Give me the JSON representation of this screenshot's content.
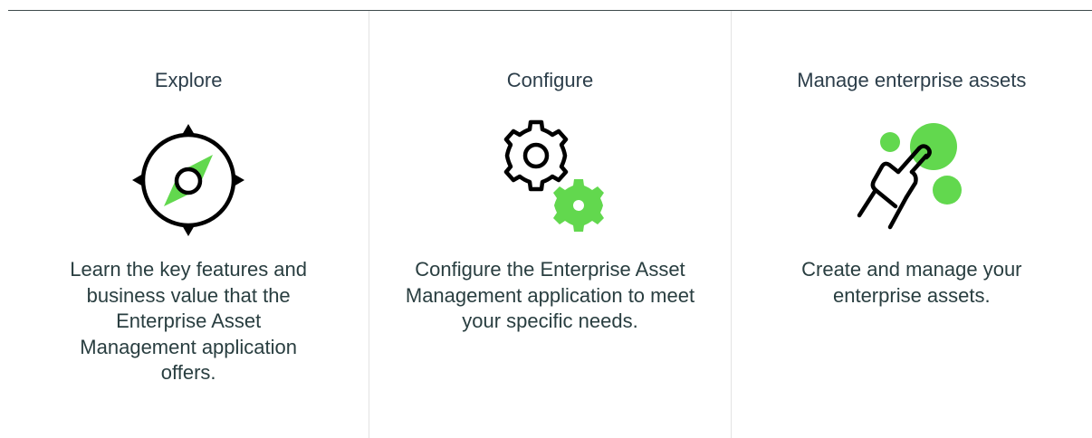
{
  "cards": [
    {
      "title": "Explore",
      "icon": "compass-icon",
      "description": "Learn the key features and business value that the Enterprise Asset Management application offers."
    },
    {
      "title": "Configure",
      "icon": "gears-icon",
      "description": "Configure the Enterprise Asset Management application to meet your specific needs."
    },
    {
      "title": "Manage enterprise assets",
      "icon": "hand-touch-icon",
      "description": "Create and manage your enterprise assets."
    }
  ],
  "colors": {
    "accent": "#62d84e",
    "text": "#293e40",
    "stroke": "#000000",
    "divider": "#e3e3e3"
  }
}
